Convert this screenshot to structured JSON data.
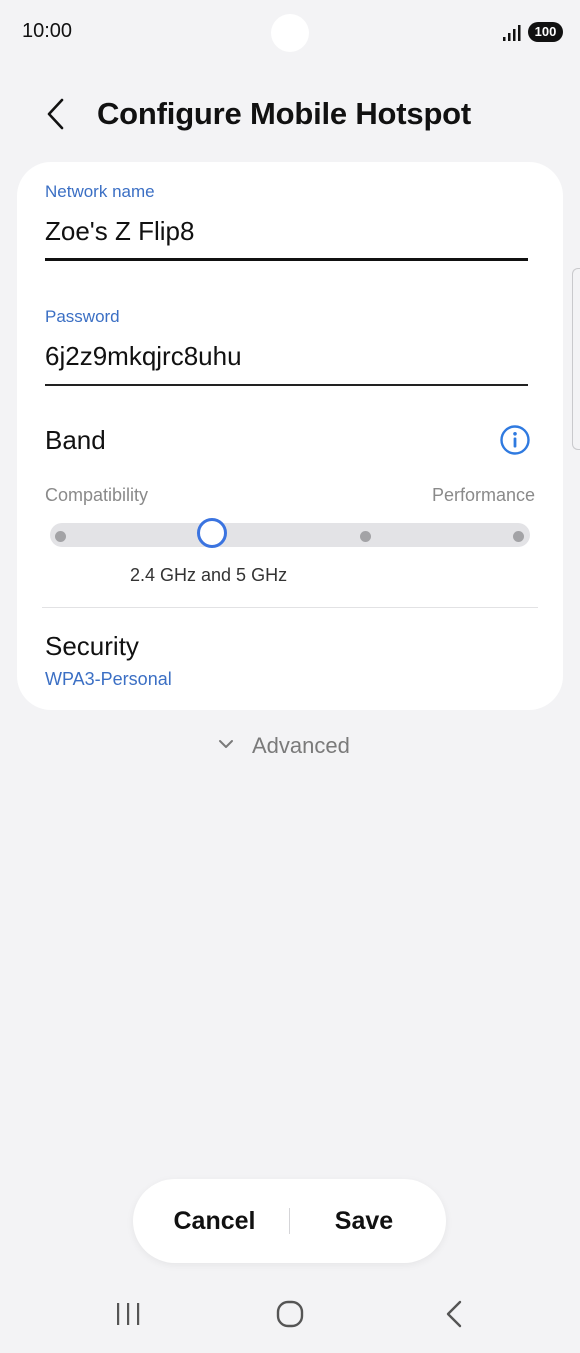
{
  "status_bar": {
    "time": "10:00",
    "battery": "100"
  },
  "header": {
    "title": "Configure Mobile Hotspot"
  },
  "form": {
    "network_name": {
      "label": "Network name",
      "value": "Zoe's Z Flip8"
    },
    "password": {
      "label": "Password",
      "value": "6j2z9mkqjrc8uhu"
    },
    "band": {
      "title": "Band",
      "left_label": "Compatibility",
      "right_label": "Performance",
      "selected_value": "2.4 GHz and 5 GHz",
      "step_count": 4,
      "selected_step": 2
    },
    "security": {
      "title": "Security",
      "value": "WPA3-Personal"
    }
  },
  "advanced": {
    "label": "Advanced"
  },
  "actions": {
    "cancel_label": "Cancel",
    "save_label": "Save"
  },
  "colors": {
    "accent": "#3b6fc4",
    "slider_thumb": "#3b74e0",
    "background": "#f3f3f5",
    "card": "#ffffff"
  }
}
